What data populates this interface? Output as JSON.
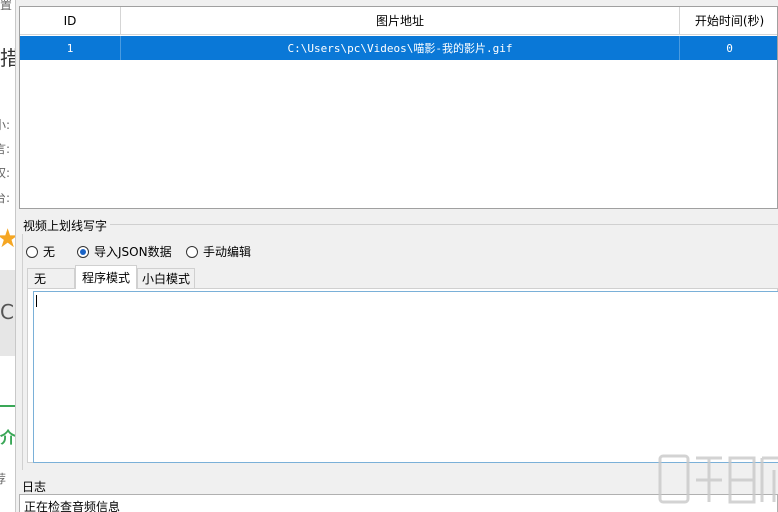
{
  "bg_window": {
    "frag_top": "置",
    "frag_big": "措",
    "frag_1": "小:",
    "frag_2": "言:",
    "frag_3": "权:",
    "frag_4": "台:",
    "frag_c": "C",
    "frag_intro": "介",
    "frag_bottom": "荐"
  },
  "table": {
    "headers": {
      "id": "ID",
      "path": "图片地址",
      "start": "开始时间(秒)"
    },
    "rows": [
      {
        "id": "1",
        "path": "C:\\Users\\pc\\Videos\\喵影-我的影片.gif",
        "start": "0"
      }
    ]
  },
  "draw_section": {
    "title": "视频上划线写字",
    "radios": [
      {
        "label": "无",
        "checked": false
      },
      {
        "label": "导入JSON数据",
        "checked": true
      },
      {
        "label": "手动编辑",
        "checked": false
      }
    ],
    "tabs": [
      {
        "label": "无",
        "active": false
      },
      {
        "label": "程序模式",
        "active": true
      },
      {
        "label": "小白模式",
        "active": false
      }
    ],
    "editor_value": ""
  },
  "log": {
    "title": "日志",
    "text": "正在检查音频信息"
  },
  "colors": {
    "selection": "#0a78d7",
    "accent": "#1a63c6"
  }
}
